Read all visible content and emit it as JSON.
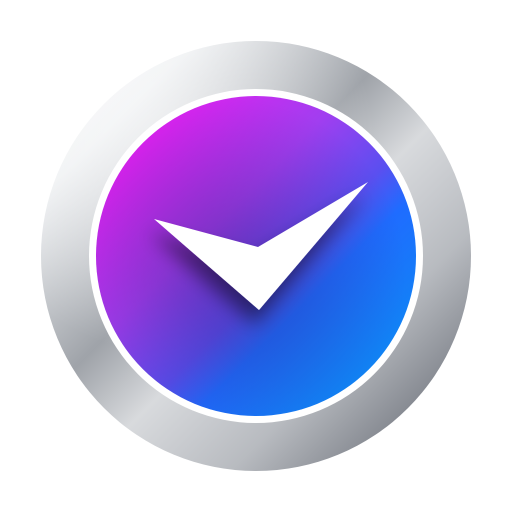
{
  "icon": {
    "name": "clock-app-icon",
    "glyph": "checkmark-clock-hands-icon"
  },
  "colors": {
    "background": "#ffffff",
    "bezel_light": "#f2f3f5",
    "bezel_mid": "#c9ccd1",
    "bezel_dark": "#7d8188",
    "inner_ring": "#ffffff",
    "face_magenta": "#e020f0",
    "face_purple": "#9a40f0",
    "face_blue": "#1f6cff",
    "face_cyan_blue": "#0f86f4",
    "hands": "#ffffff"
  }
}
